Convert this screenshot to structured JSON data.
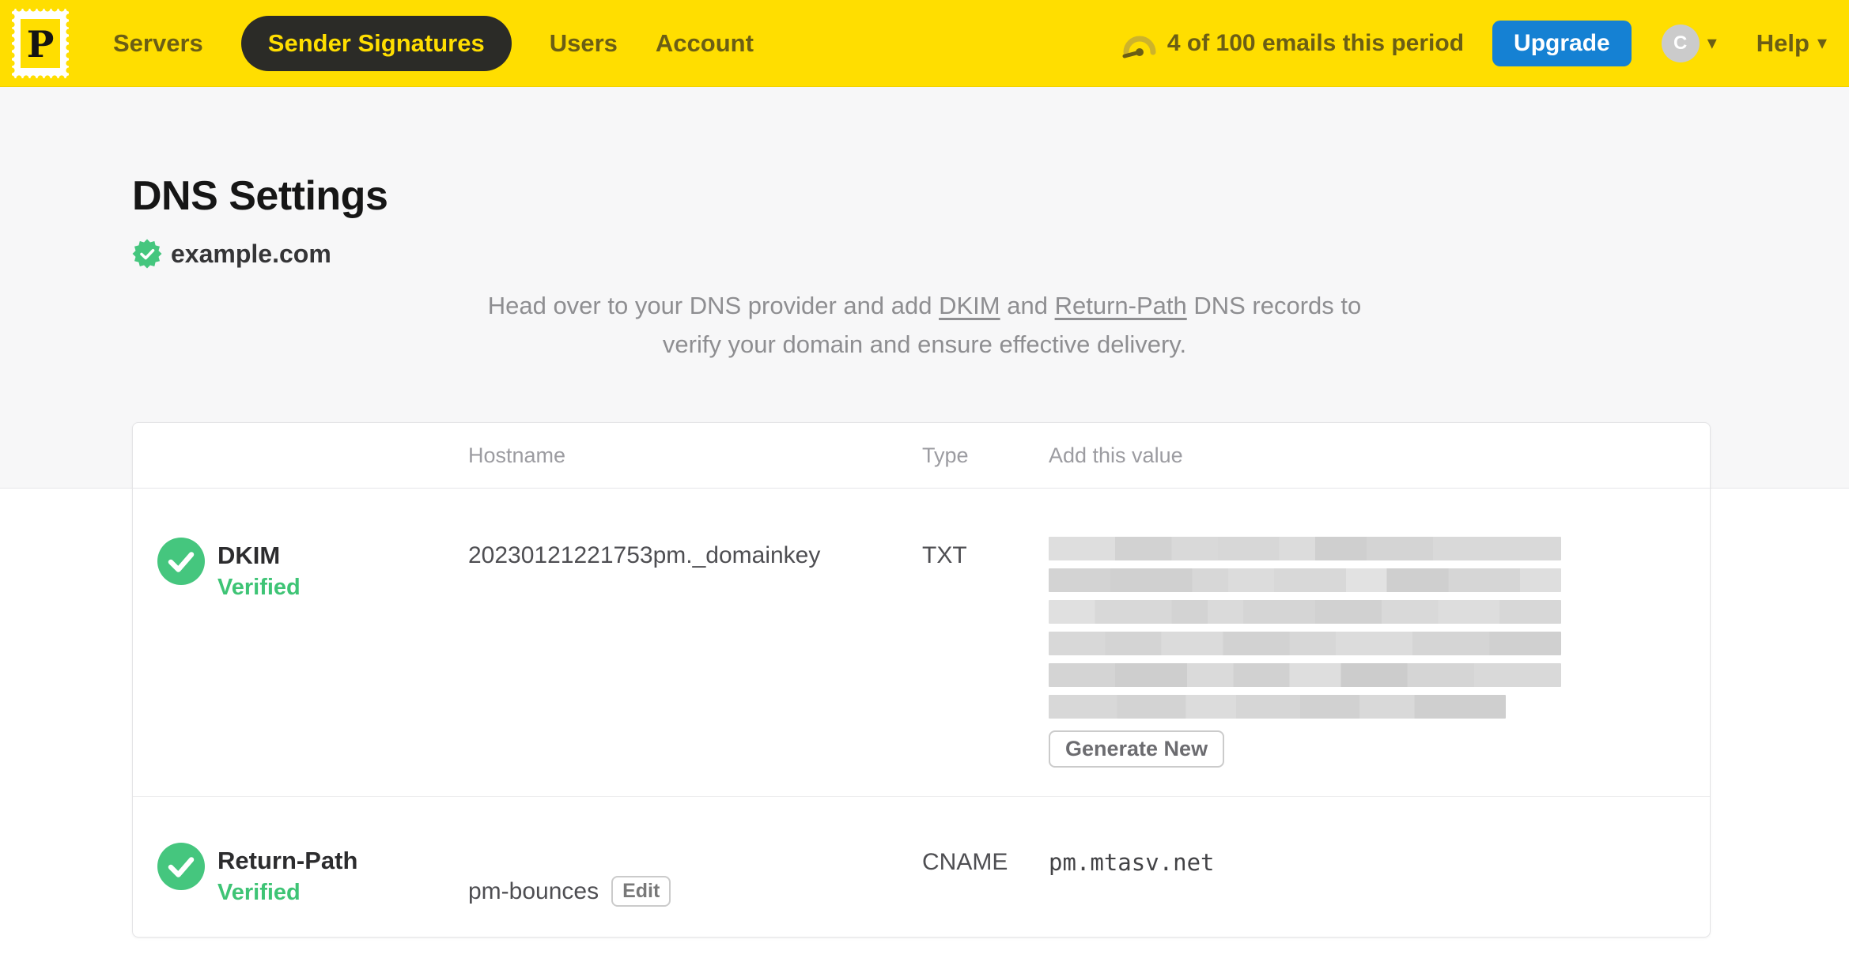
{
  "navbar": {
    "logo": {
      "letter": "P"
    },
    "items": [
      {
        "label": "Servers",
        "active": false
      },
      {
        "label": "Sender Signatures",
        "active": true
      },
      {
        "label": "Users",
        "active": false
      },
      {
        "label": "Account",
        "active": false
      }
    ],
    "usage_text": "4 of 100 emails this period",
    "upgrade_label": "Upgrade",
    "avatar_initial": "C",
    "help_label": "Help",
    "caret_glyph": "▾"
  },
  "hero": {
    "title": "DNS Settings",
    "domain": "example.com",
    "description": {
      "p1": "Head over to your DNS provider and add",
      "link_dkim": "DKIM",
      "p2": "and",
      "link_return_path": "Return-Path",
      "p3": "DNS records to",
      "line2": "verify your domain and ensure effective delivery."
    }
  },
  "table": {
    "headers": {
      "hostname": "Hostname",
      "type": "Type",
      "value": "Add this value"
    },
    "rows": [
      {
        "name": "DKIM",
        "status": "Verified",
        "hostname": "20230121221753pm._domainkey",
        "type": "TXT",
        "value_redacted": true,
        "value_redacted_lines": 6,
        "action_label": "Generate New"
      },
      {
        "name": "Return-Path",
        "status": "Verified",
        "hostname": "pm-bounces",
        "edit_label": "Edit",
        "type": "CNAME",
        "value": "pm.mtasv.net"
      }
    ]
  },
  "colors": {
    "brand_yellow": "#FFDE00",
    "nav_text": "#6B5E15",
    "active_pill_bg": "#2B2B27",
    "upgrade_blue": "#1581D3",
    "success_green": "#45C67E",
    "redacted_gray": "#D6D6D6"
  }
}
